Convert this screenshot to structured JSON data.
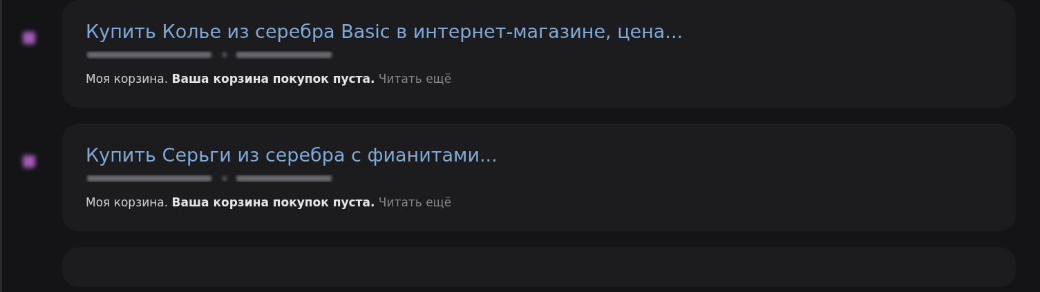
{
  "results": [
    {
      "title": "Купить Колье из серебра Basic в интернет-магазине, цена...",
      "snippet": "Моя корзина. **Ваша корзина покупок пуста.**",
      "more_link": "Читать ещё"
    },
    {
      "title": "Купить Серьги из серебра с фианитами...",
      "snippet": "Моя корзина. **Ваша корзина покупок пуста.**",
      "more_link": "Читать ещё"
    }
  ]
}
